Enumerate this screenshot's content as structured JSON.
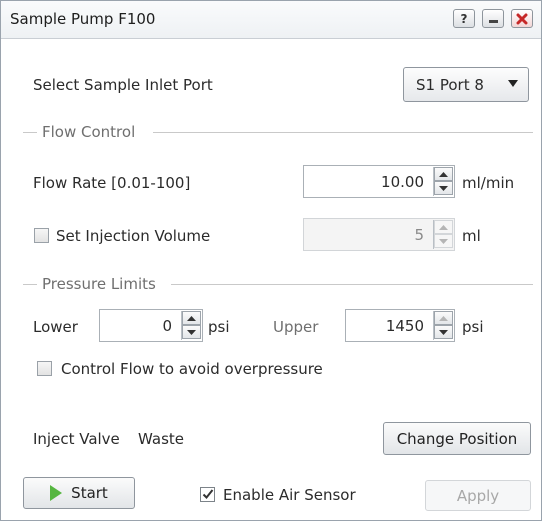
{
  "window": {
    "title": "Sample Pump F100",
    "help_glyph": "?"
  },
  "inlet": {
    "label": "Select Sample Inlet Port",
    "selected": "S1 Port 8"
  },
  "flow_control": {
    "group_label": "Flow Control",
    "flow_rate_label": "Flow Rate [0.01-100]",
    "flow_rate_value": "10.00",
    "flow_rate_unit": "ml/min",
    "injection_label": "Set Injection Volume",
    "injection_checked": false,
    "injection_value": "5",
    "injection_unit": "ml"
  },
  "pressure_limits": {
    "group_label": "Pressure Limits",
    "lower_label": "Lower",
    "lower_value": "0",
    "lower_unit": "psi",
    "upper_label": "Upper",
    "upper_value": "1450",
    "upper_unit": "psi",
    "control_flow_label": "Control Flow to avoid overpressure",
    "control_flow_checked": false
  },
  "valve": {
    "label": "Inject Valve",
    "state": "Waste",
    "change_button": "Change Position"
  },
  "footer": {
    "start_button": "Start",
    "air_sensor_label": "Enable Air Sensor",
    "air_sensor_checked": true,
    "apply_button": "Apply"
  },
  "colors": {
    "start_icon": "#56b640",
    "close_icon": "#c62828"
  },
  "icons": {
    "help": "question-mark-icon",
    "minimize": "minimize-icon",
    "close": "close-x-icon",
    "dropdown": "chevron-down-icon",
    "start": "play-icon"
  }
}
